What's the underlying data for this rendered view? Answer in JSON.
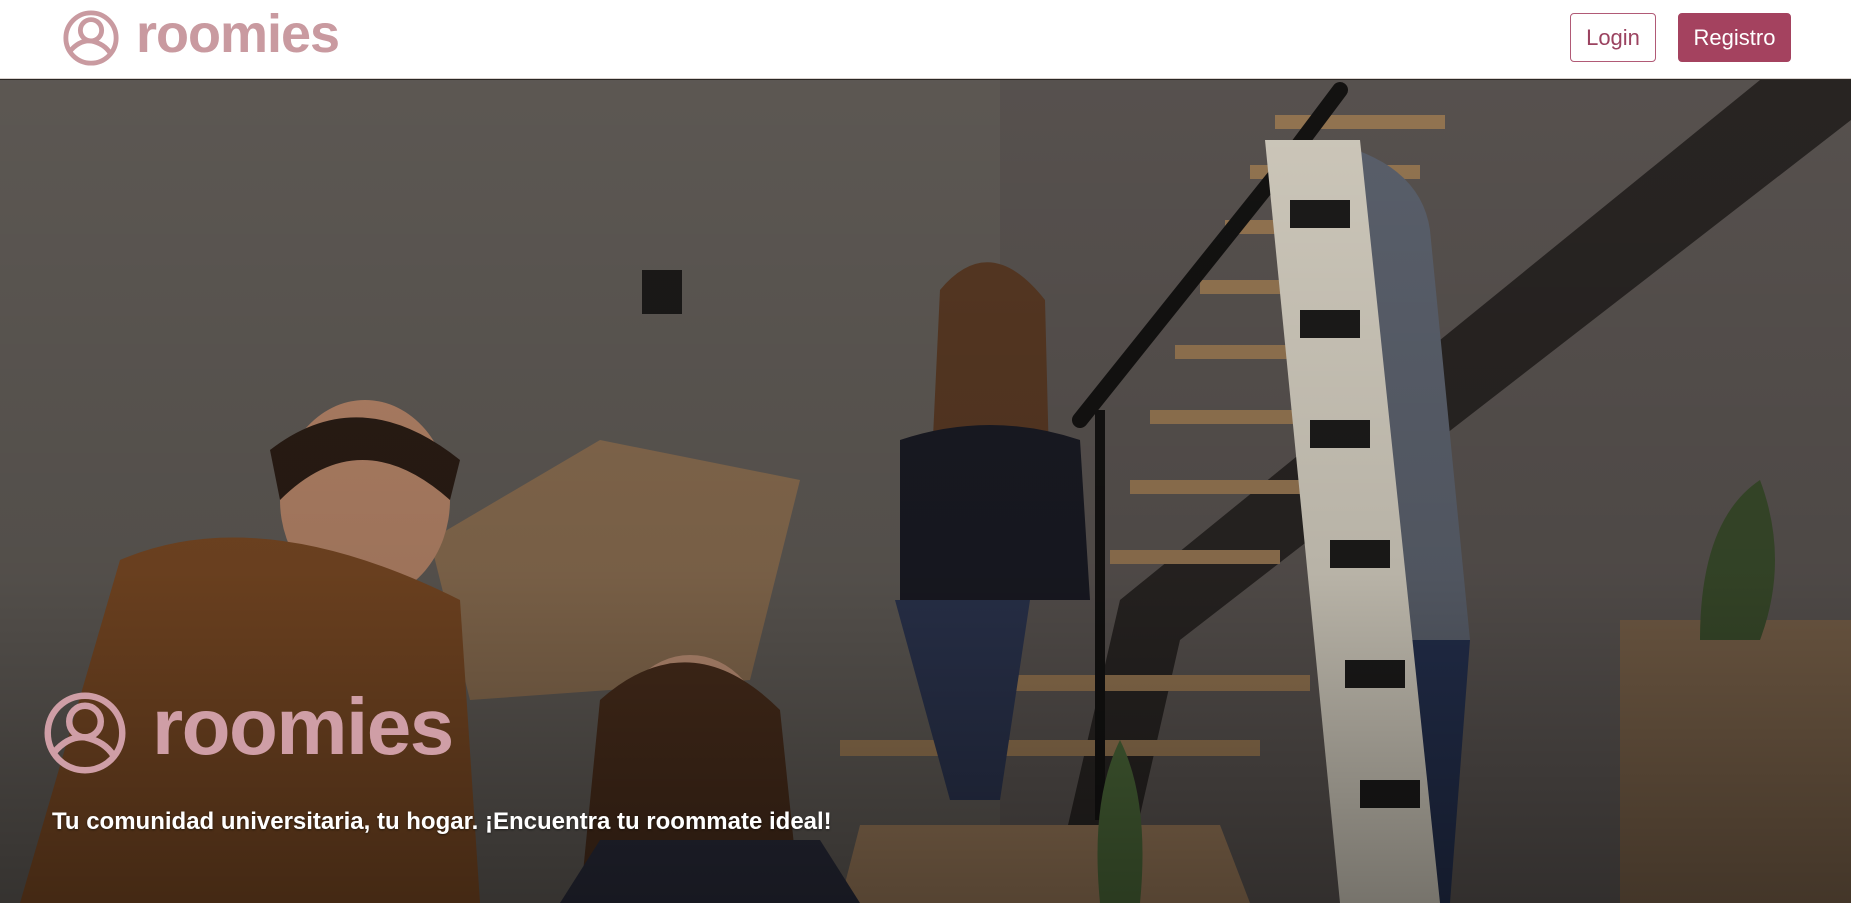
{
  "brand": {
    "name": "roomies",
    "color": "#c99aa0",
    "icon": "roomies-logo-icon"
  },
  "navbar": {
    "login_label": "Login",
    "register_label": "Registro",
    "accent_color": "#a4425f"
  },
  "hero": {
    "logo_text": "roomies",
    "tagline": "Tu comunidad universitaria, tu hogar. ¡Encuentra tu roommate ideal!",
    "image": "hero-photo"
  }
}
